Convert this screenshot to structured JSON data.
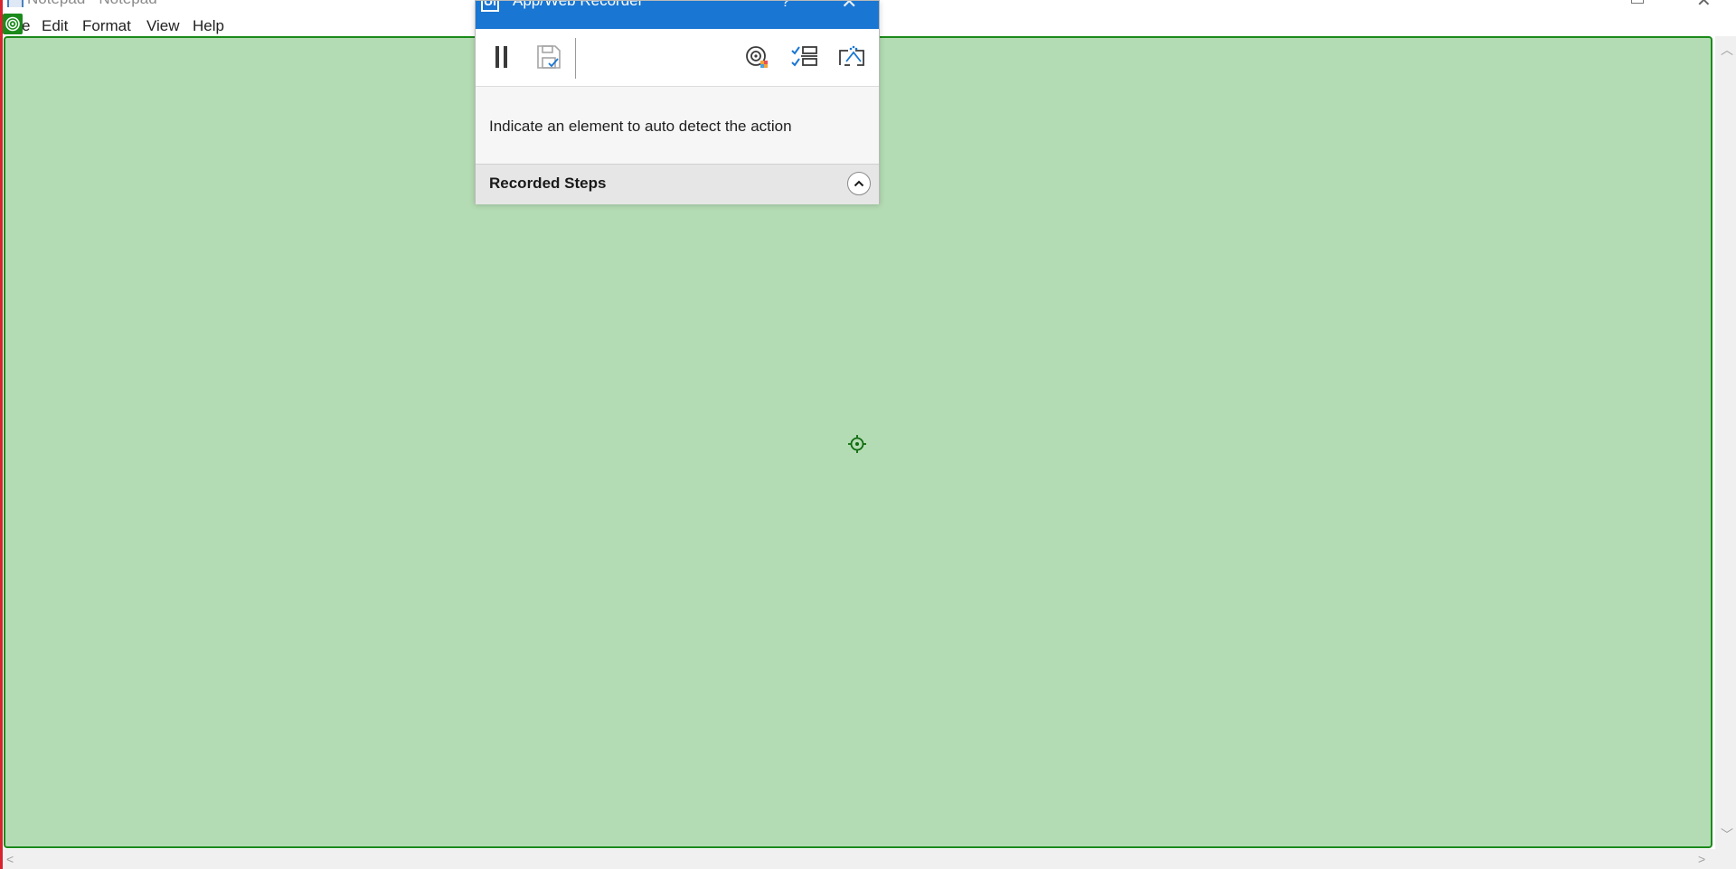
{
  "notepad": {
    "title": "Notepad - Notepad",
    "menu": {
      "file_partial": "e",
      "edit": "Edit",
      "format": "Format",
      "view": "View",
      "help": "Help"
    }
  },
  "recorder": {
    "title": "App/Web Recorder",
    "logo": "Ui",
    "help_glyph": "?",
    "close_glyph": "✕",
    "message": "Indicate an element to auto detect the action",
    "recorded_steps_label": "Recorded Steps",
    "toolbar": {
      "pause_icon": "pause-icon",
      "save_icon": "save-icon",
      "record_icon": "target-record-icon",
      "steps_icon": "checklist-icon",
      "select_icon": "screen-select-icon"
    }
  },
  "colors": {
    "highlight_fill": "#b4dcb4",
    "highlight_border": "#1b8a1b",
    "recorder_accent": "#1976d2",
    "left_edge": "#d9232e"
  }
}
